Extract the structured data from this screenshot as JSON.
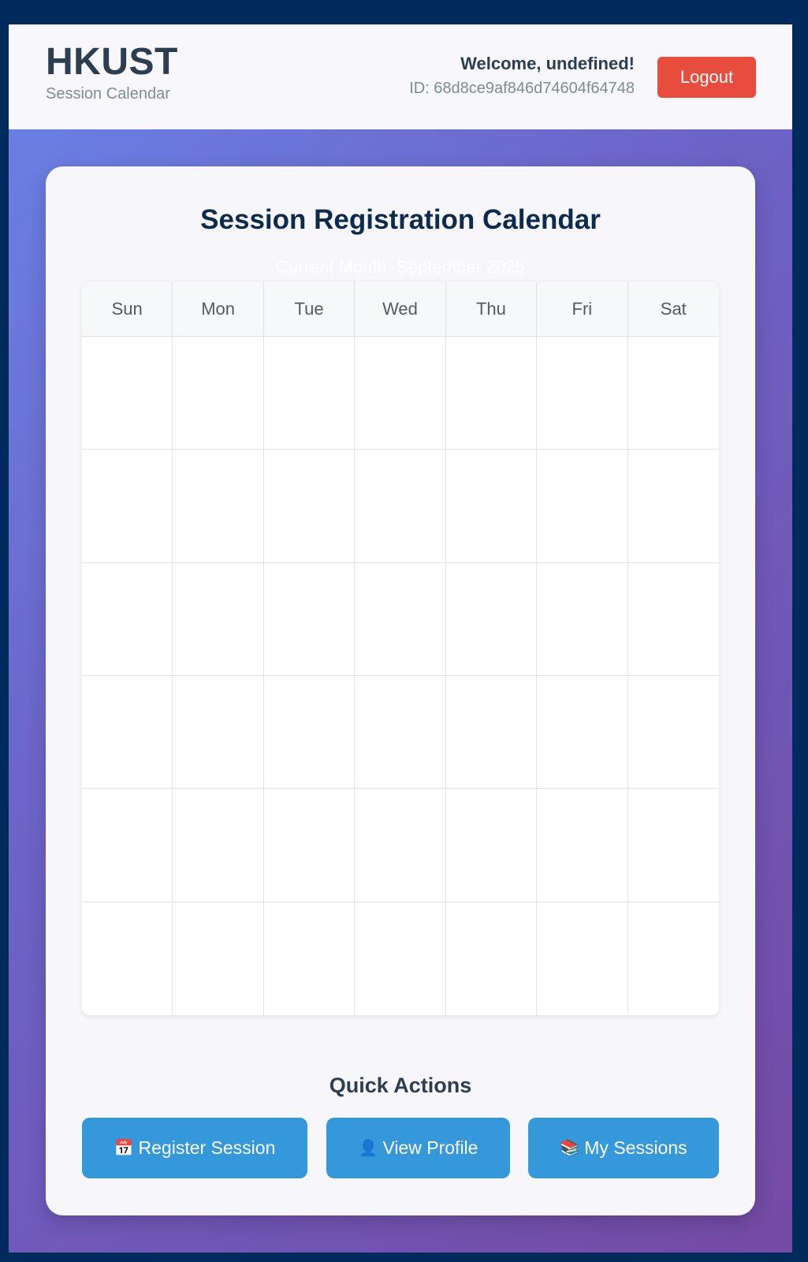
{
  "header": {
    "brand_title": "HKUST",
    "brand_subtitle": "Session Calendar",
    "welcome_text": "Welcome, undefined!",
    "user_id_text": "ID: 68d8ce9af846d74604f64748",
    "logout_label": "Logout"
  },
  "calendar": {
    "title": "Session Registration Calendar",
    "month_label": "Current Month: September 2025",
    "weekdays": [
      "Sun",
      "Mon",
      "Tue",
      "Wed",
      "Thu",
      "Fri",
      "Sat"
    ],
    "week_rows": 6
  },
  "quick_actions": {
    "title": "Quick Actions",
    "buttons": [
      {
        "icon": "📅",
        "icon_name": "calendar-icon",
        "label": "Register Session"
      },
      {
        "icon": "👤",
        "icon_name": "user-icon",
        "label": "View Profile"
      },
      {
        "icon": "📚",
        "icon_name": "books-icon",
        "label": "My Sessions"
      }
    ]
  },
  "colors": {
    "page_border": "#002b5c",
    "logout": "#e74c3c",
    "action_button": "#3498db",
    "title_text": "#0d2a4f",
    "gradient_start": "#6a7fe3",
    "gradient_end": "#744aa3"
  }
}
